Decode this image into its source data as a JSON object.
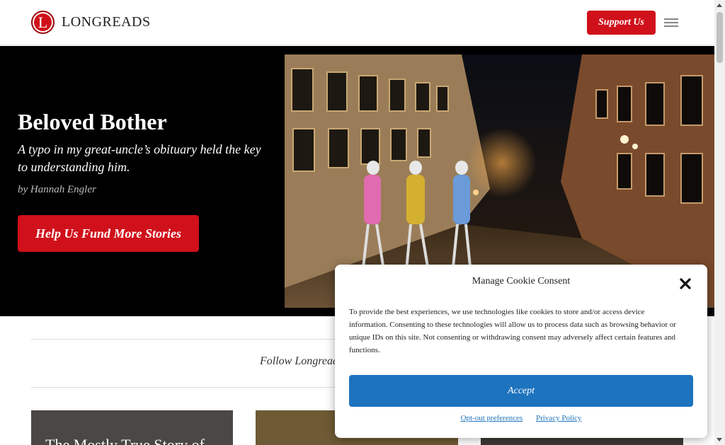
{
  "header": {
    "logo_letter": "L",
    "logo_text": "LONGREADS",
    "support_label": "Support Us",
    "menu_icon": "hamburger-menu-icon"
  },
  "hero": {
    "title": "Beloved Bother",
    "dek": "A typo in my great-uncle’s obituary held the key to understanding him.",
    "byline": "by Hannah Engler",
    "cta_label": "Help Us Fund More Stories"
  },
  "follow": {
    "text": "Follow Longreads"
  },
  "cards": [
    {
      "title": "The Mostly True Story of"
    },
    {
      "title": ""
    },
    {
      "title": ""
    }
  ],
  "cookie": {
    "title": "Manage Cookie Consent",
    "body": "To provide the best experiences, we use technologies like cookies to store and/or access device information. Consenting to these technologies will allow us to process data such as browsing behavior or unique IDs on this site. Not consenting or withdrawing consent may adversely affect certain features and functions.",
    "accept_label": "Accept",
    "opt_out_label": "Opt-out preferences",
    "privacy_label": "Privacy Policy",
    "close_icon": "close-icon"
  },
  "colors": {
    "brand_red": "#d0101a",
    "accept_blue": "#1e73be"
  }
}
